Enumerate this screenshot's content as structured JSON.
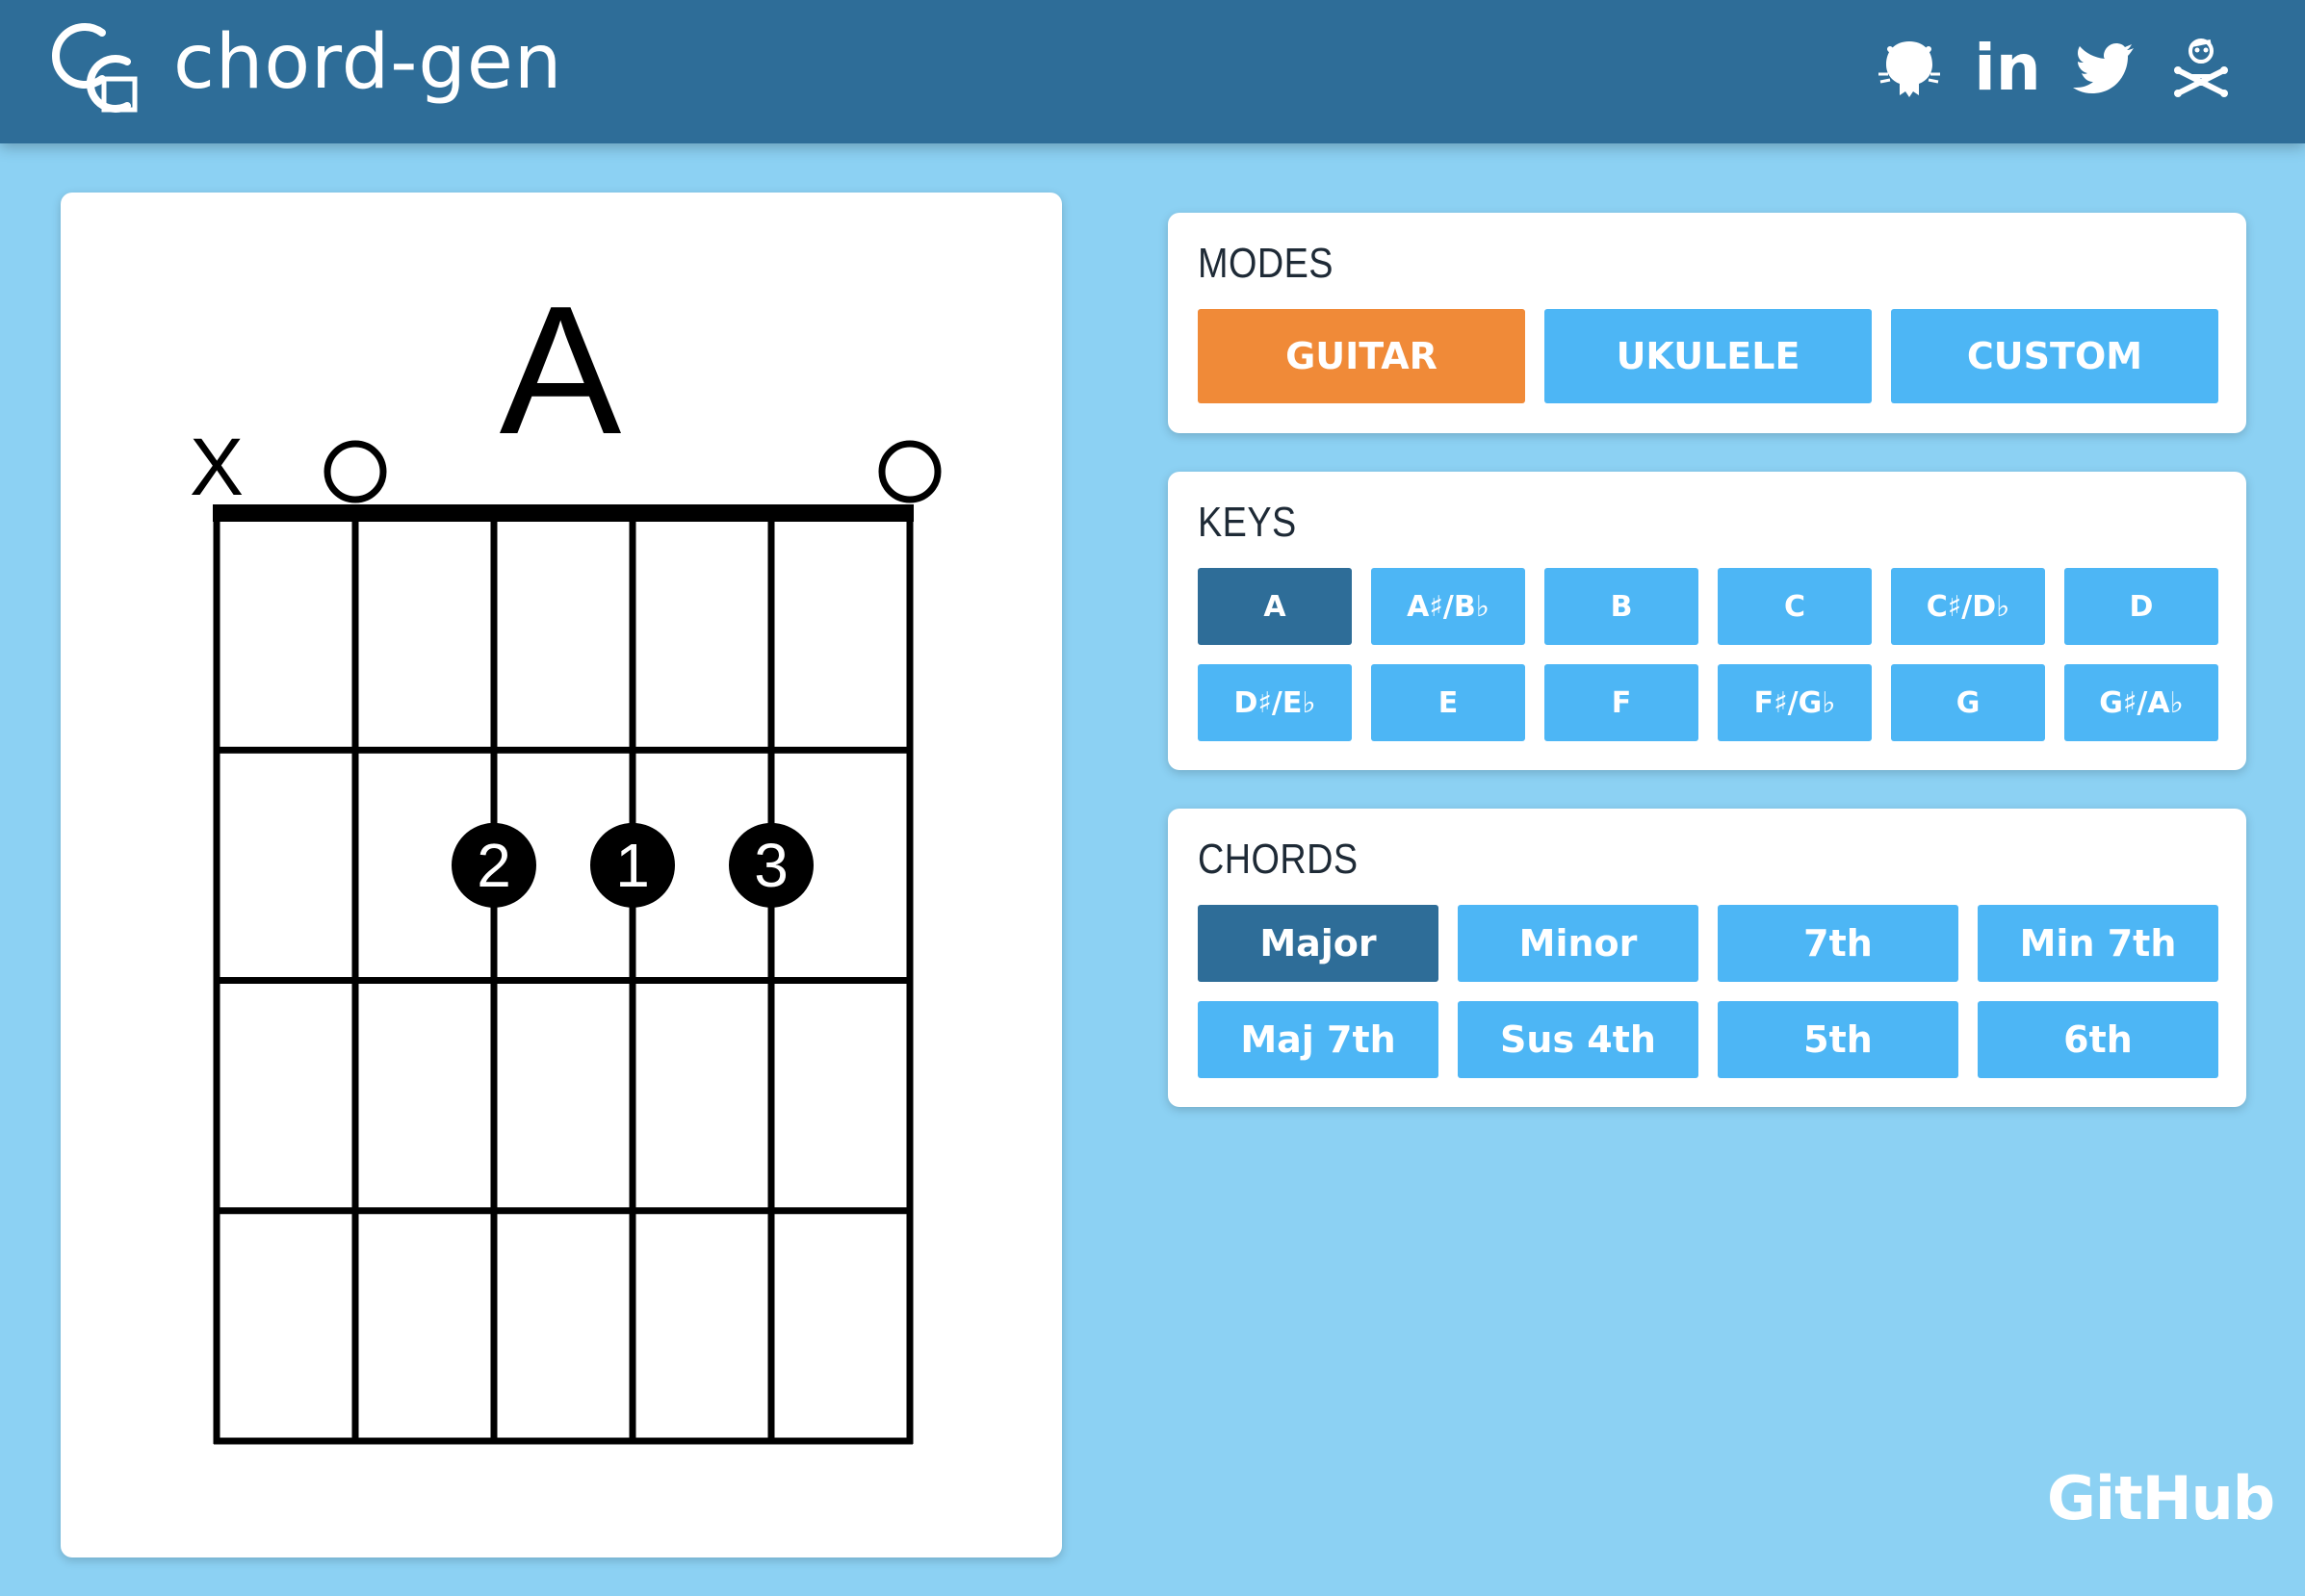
{
  "app": {
    "title": "chord-gen"
  },
  "header": {
    "social_icons": [
      "github-icon",
      "linkedin-icon",
      "twitter-icon",
      "skull-crossbones-icon"
    ],
    "linkedin_label": "in"
  },
  "diagram": {
    "chord_name": "A",
    "string_markers": [
      "X",
      "O",
      "",
      "",
      "",
      "O"
    ],
    "fingers": [
      {
        "string": 3,
        "fret": 2,
        "label": "2"
      },
      {
        "string": 4,
        "fret": 2,
        "label": "1"
      },
      {
        "string": 5,
        "fret": 2,
        "label": "3"
      }
    ],
    "num_strings": 6,
    "num_frets": 4
  },
  "modes": {
    "title": "MODES",
    "items": [
      "GUITAR",
      "UKULELE",
      "CUSTOM"
    ],
    "active": "GUITAR"
  },
  "keys": {
    "title": "KEYS",
    "items": [
      "A",
      "A♯/B♭",
      "B",
      "C",
      "C♯/D♭",
      "D",
      "D♯/E♭",
      "E",
      "F",
      "F♯/G♭",
      "G",
      "G♯/A♭"
    ],
    "active": "A"
  },
  "chords": {
    "title": "CHORDS",
    "items": [
      "Major",
      "Minor",
      "7th",
      "Min 7th",
      "Maj 7th",
      "Sus 4th",
      "5th",
      "6th"
    ],
    "active": "Major"
  },
  "footer": {
    "github_label": "GitHub"
  },
  "colors": {
    "background": "#8cd1f3",
    "header": "#2e6d98",
    "button": "#4db6f5",
    "button_active": "#2e6d98",
    "mode_active": "#f08a38"
  }
}
